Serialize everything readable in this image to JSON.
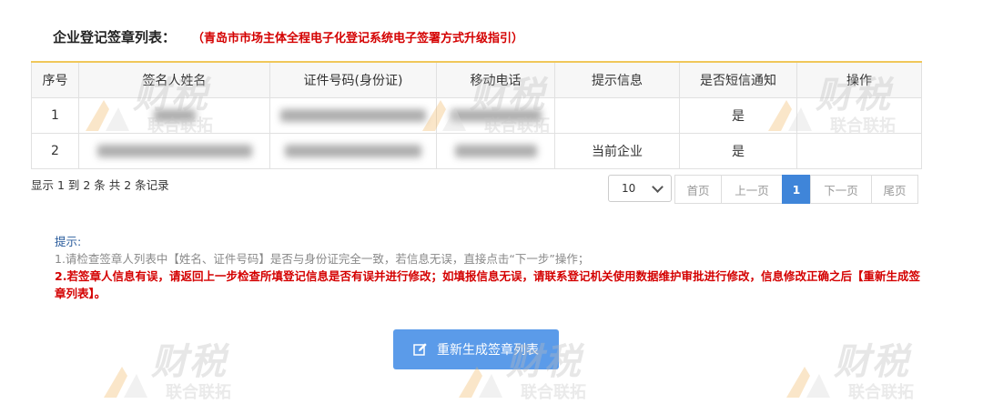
{
  "header": {
    "title": "企业登记签章列表：",
    "guide_link": "（青岛市市场主体全程电子化登记系统电子签署方式升级指引）"
  },
  "table": {
    "columns": [
      "序号",
      "签名人姓名",
      "证件号码(身份证)",
      "移动电话",
      "提示信息",
      "是否短信通知",
      "操作"
    ],
    "rows": [
      {
        "index": "1",
        "name": "",
        "id": "",
        "phone": "",
        "hint": "",
        "sms": "是",
        "op": ""
      },
      {
        "index": "2",
        "name": "",
        "id": "",
        "phone": "",
        "hint": "当前企业",
        "sms": "是",
        "op": ""
      }
    ]
  },
  "summary": "显示 1 到 2 条 共 2 条记录",
  "pagination": {
    "page_size": "10",
    "first": "首页",
    "prev": "上一页",
    "current": "1",
    "next": "下一页",
    "last": "尾页"
  },
  "tips": {
    "label": "提示:",
    "line1": "1.请检查签章人列表中【姓名、证件号码】是否与身份证完全一致，若信息无误，直接点击“下一步”操作；",
    "line2": "2.若签章人信息有误，请返回上一步检查所填登记信息是否有误并进行修改；如填报信息无误，请联系登记机关使用数据维护审批进行修改，信息修改正确之后【重新生成签章列表】。"
  },
  "regenerate_button": "重新生成签章列表",
  "watermark": {
    "big": "财税",
    "small": "联合联拓"
  },
  "colors": {
    "accent": "#3f85d9",
    "button": "#5b9be9",
    "warning": "#d40000",
    "table_top_border": "#f0c75a"
  }
}
